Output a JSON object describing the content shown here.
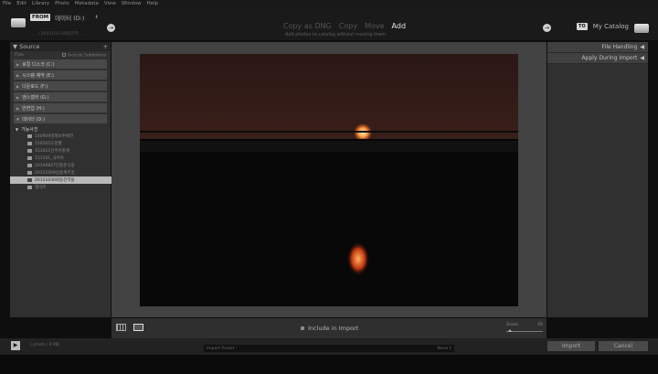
{
  "menu": [
    "File",
    "Edit",
    "Library",
    "Photo",
    "Metadata",
    "View",
    "Window",
    "Help"
  ],
  "header": {
    "from_label": "FROM",
    "from_source": "데이터 (D:)",
    "from_path": "... \\ 2015103 0회동전역 ...",
    "modes": [
      "Copy as DNG",
      "Copy",
      "Move",
      "Add"
    ],
    "mode_description": "Add photos to catalog without moving them",
    "to_label": "TO",
    "catalog": "My Catalog"
  },
  "source": {
    "title": "Source",
    "add": "+",
    "files_label": "Files",
    "include_subfolders": "Include Subfolders",
    "drives": [
      "로컬 디스크 (C:)",
      "시스템 예약 (E:)",
      "다운로드 (F:)",
      "엔스갤러 (G:)",
      "반변업 (H:)",
      "데이터 (D:)"
    ],
    "root_folder": "가능사진",
    "folders": [
      "140909경례보추에전",
      "150501도봉월",
      "151011인주유홍계",
      "151101_국미아",
      "20140827인홍준식랑",
      "20151009삼송계주골",
      "20151030회동전역들",
      "열미즈"
    ],
    "selected_index": 6
  },
  "right": {
    "items": [
      "File Handling",
      "Apply During Import"
    ]
  },
  "toolbar": {
    "include_label": "Include in Import",
    "zoom_label": "Zoom",
    "fit_label": "Fit"
  },
  "footer": {
    "play_icon": "▶",
    "count": "1 photo / 4 MB",
    "preset_label": "Import Preset :",
    "preset_value": "None ‡",
    "import_button": "Import",
    "cancel_button": "Cancel"
  }
}
